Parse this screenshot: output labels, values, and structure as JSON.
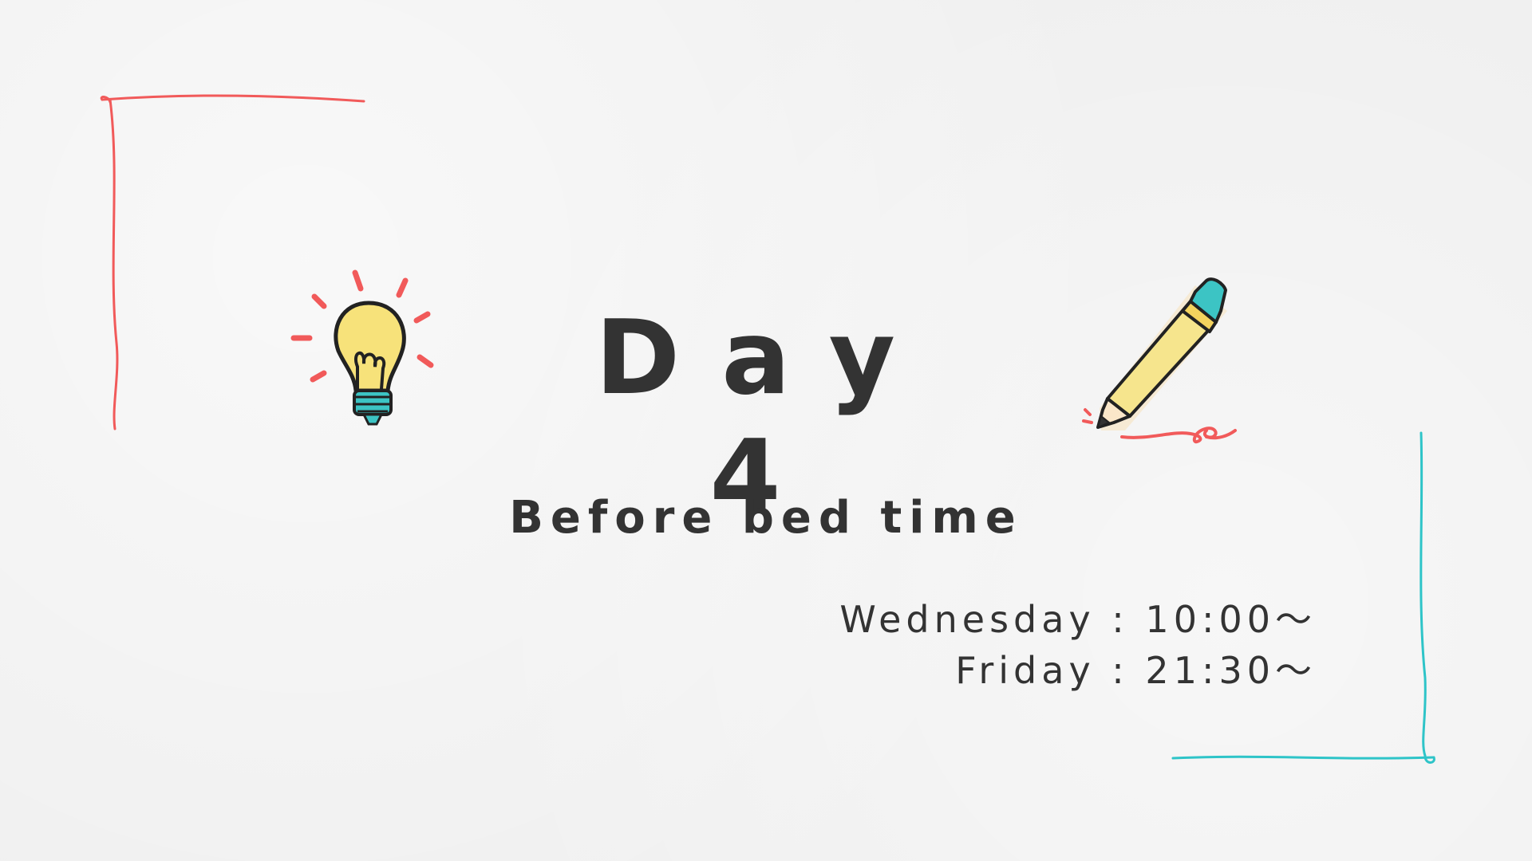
{
  "title": "Day 4",
  "subtitle": "Before bed time",
  "schedule": [
    {
      "day": "Wednesday",
      "time": "10:00〜"
    },
    {
      "day": "Friday",
      "time": "21:30〜"
    }
  ],
  "icons": [
    "lightbulb-icon",
    "pencil-icon"
  ],
  "colors": {
    "text": "#333333",
    "frame_red": "#f15a5a",
    "frame_teal": "#2ec4c8",
    "bulb_yellow": "#f7e27a",
    "pencil_yellow": "#f6e58d",
    "eraser_teal": "#3cc4c4"
  }
}
